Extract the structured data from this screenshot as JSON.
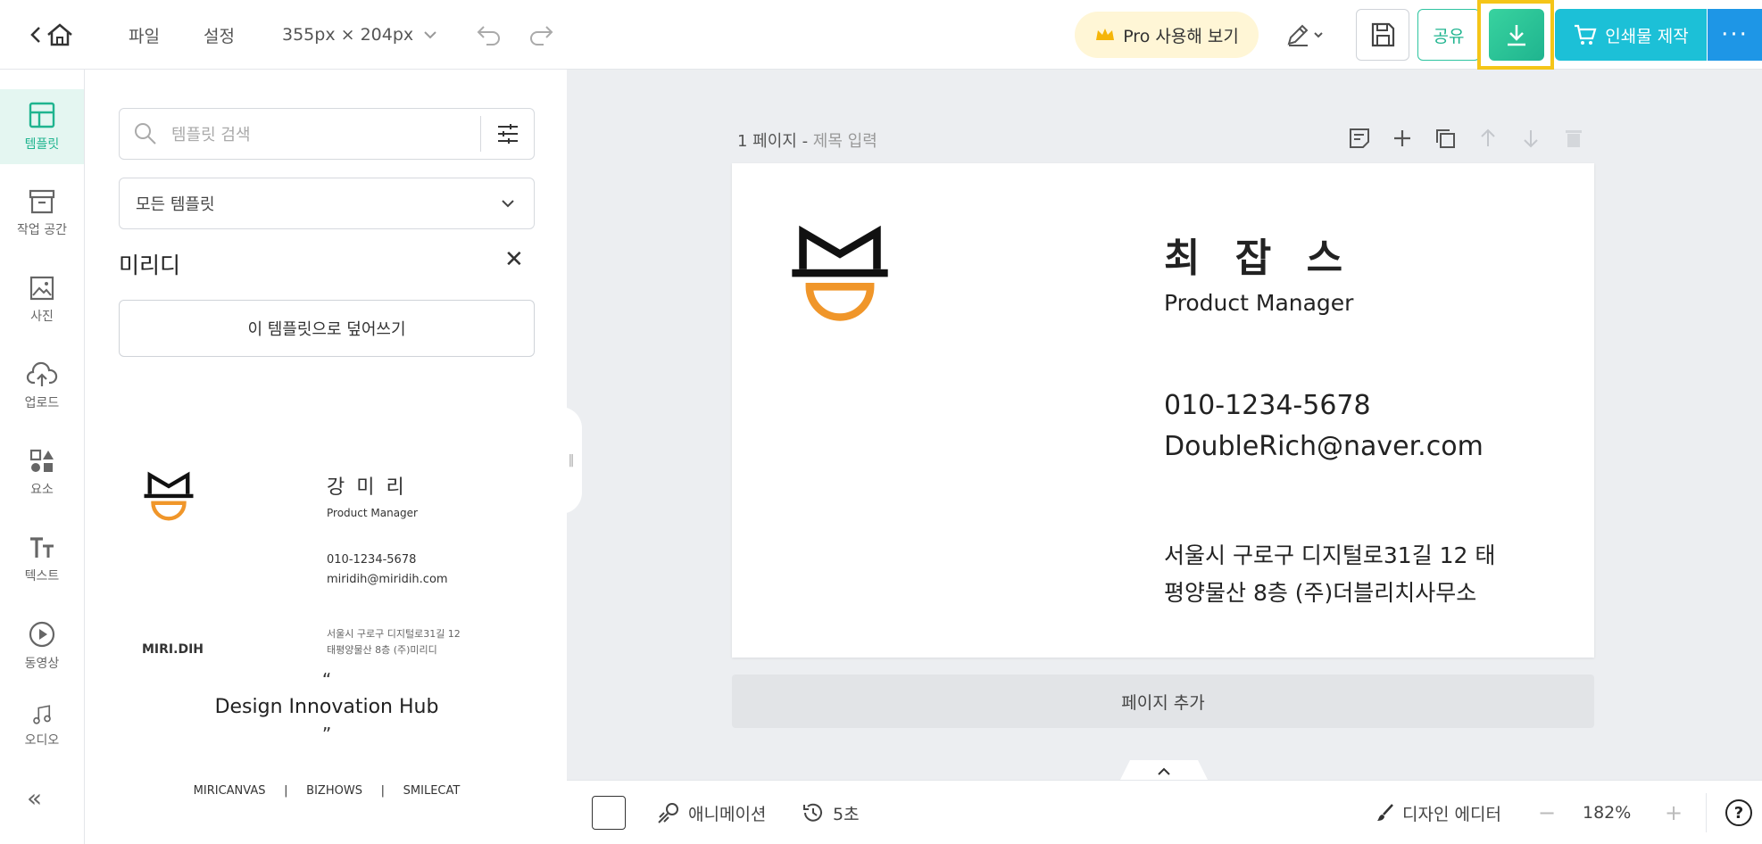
{
  "header": {
    "file_menu": "파일",
    "settings_menu": "설정",
    "size": "355px × 204px",
    "pro_button": "Pro 사용해 보기",
    "share_button": "공유",
    "print_button": "인쇄물 제작",
    "more_button": "···"
  },
  "leftnav": {
    "items": [
      {
        "label": "템플릿"
      },
      {
        "label": "작업 공간"
      },
      {
        "label": "사진"
      },
      {
        "label": "업로드"
      },
      {
        "label": "요소"
      },
      {
        "label": "텍스트"
      },
      {
        "label": "동영상"
      },
      {
        "label": "오디오"
      }
    ],
    "collapse": "«"
  },
  "panel": {
    "search_placeholder": "템플릿 검색",
    "category_select": "모든 템플릿",
    "category_title": "미리디",
    "close": "✕",
    "overwrite_button": "이 템플릿으로 덮어쓰기",
    "thumb1": {
      "name": "강 미 리",
      "role": "Product Manager",
      "phone": "010-1234-5678",
      "email": "miridih@miridih.com",
      "brand": "MIRI.DIH",
      "addr1": "서울시 구로구 디지털로31길 12",
      "addr2": "태평양물산 8층 (주)미리디"
    },
    "thumb2": {
      "open_quote": "“",
      "title": "Design Innovation Hub",
      "close_quote": "”",
      "brands": "MIRICANVAS     |     BIZHOWS     |     SMILECAT"
    }
  },
  "canvas": {
    "page_number": "1 페이지 - ",
    "page_title_placeholder": "제목 입력",
    "card": {
      "name": "최 잡 스",
      "role": "Product Manager",
      "phone": "010-1234-5678",
      "email": "DoubleRich@naver.com",
      "addr1": "서울시 구로구 디지털로31길 12 태",
      "addr2": "평양물산 8층 (주)더블리치사무소"
    },
    "add_page": "페이지 추가"
  },
  "bottombar": {
    "animation": "애니메이션",
    "duration": "5초",
    "design_editor": "디자인 에디터",
    "zoom_minus": "−",
    "zoom": "182%",
    "zoom_plus": "+",
    "help": "?"
  },
  "colors": {
    "accent_green": "#1fb48f",
    "print_cyan": "#1cc0d7",
    "more_blue": "#1e96e6",
    "highlight": "#f5c518",
    "logo_orange": "#f0962a"
  }
}
